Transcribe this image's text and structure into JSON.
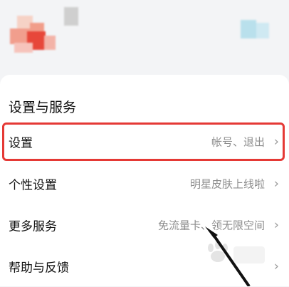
{
  "section": {
    "title": "设置与服务"
  },
  "rows": [
    {
      "label": "设置",
      "value": "帐号、退出",
      "highlighted": true
    },
    {
      "label": "个性设置",
      "value": "明星皮肤上线啦"
    },
    {
      "label": "更多服务",
      "value": "免流量卡、领无限空间"
    },
    {
      "label": "帮助与反馈",
      "value": ""
    }
  ],
  "icons": {
    "chevron": "chevron-right-icon"
  },
  "colors": {
    "highlight": "#e53935",
    "annotation_arrow": "#111111"
  }
}
